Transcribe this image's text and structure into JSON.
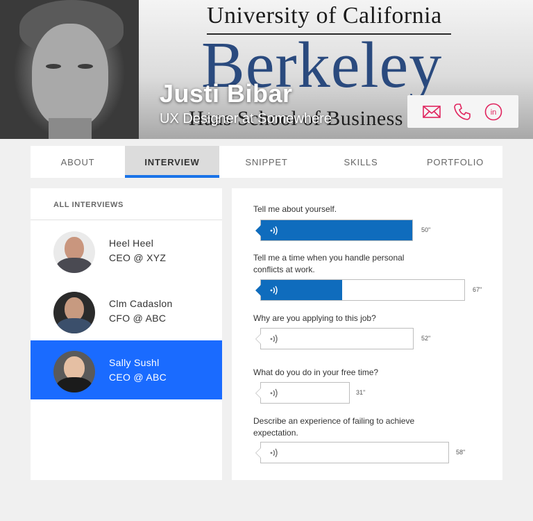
{
  "profile": {
    "name": "Justi Bibar",
    "role": "UX Designer at Somewhere"
  },
  "banner": {
    "line1": "University of California",
    "line2": "Berkeley",
    "line3": "Haas School of Business"
  },
  "contact_icons": [
    "mail-icon",
    "phone-icon",
    "linkedin-icon"
  ],
  "accent_color": "#1a73e8",
  "icon_color": "#e0245e",
  "tabs": [
    {
      "label": "ABOUT",
      "active": false
    },
    {
      "label": "INTERVIEW",
      "active": true
    },
    {
      "label": "SNIPPET",
      "active": false
    },
    {
      "label": "SKILLS",
      "active": false
    },
    {
      "label": "PORTFOLIO",
      "active": false
    }
  ],
  "interviews": {
    "heading": "ALL INTERVIEWS",
    "people": [
      {
        "name": "Heel Heel",
        "title": "CEO @ XYZ",
        "selected": false
      },
      {
        "name": "Clm Cadaslon",
        "title": "CFO @ ABC",
        "selected": false
      },
      {
        "name": "Sally Sushl",
        "title": "CEO @ ABC",
        "selected": true
      }
    ]
  },
  "questions": [
    {
      "text": "Tell me about yourself.",
      "duration": "50\"",
      "progress": 1.0
    },
    {
      "text": "Tell me a time when you handle personal conflicts at work.",
      "duration": "67\"",
      "progress": 0.4
    },
    {
      "text": "Why are you applying to this job?",
      "duration": "52\"",
      "progress": 0
    },
    {
      "text": "What do you do in your free time?",
      "duration": "31\"",
      "progress": 0
    },
    {
      "text": "Describe an experience of failing to achieve expectation.",
      "duration": "58\"",
      "progress": 0
    }
  ]
}
